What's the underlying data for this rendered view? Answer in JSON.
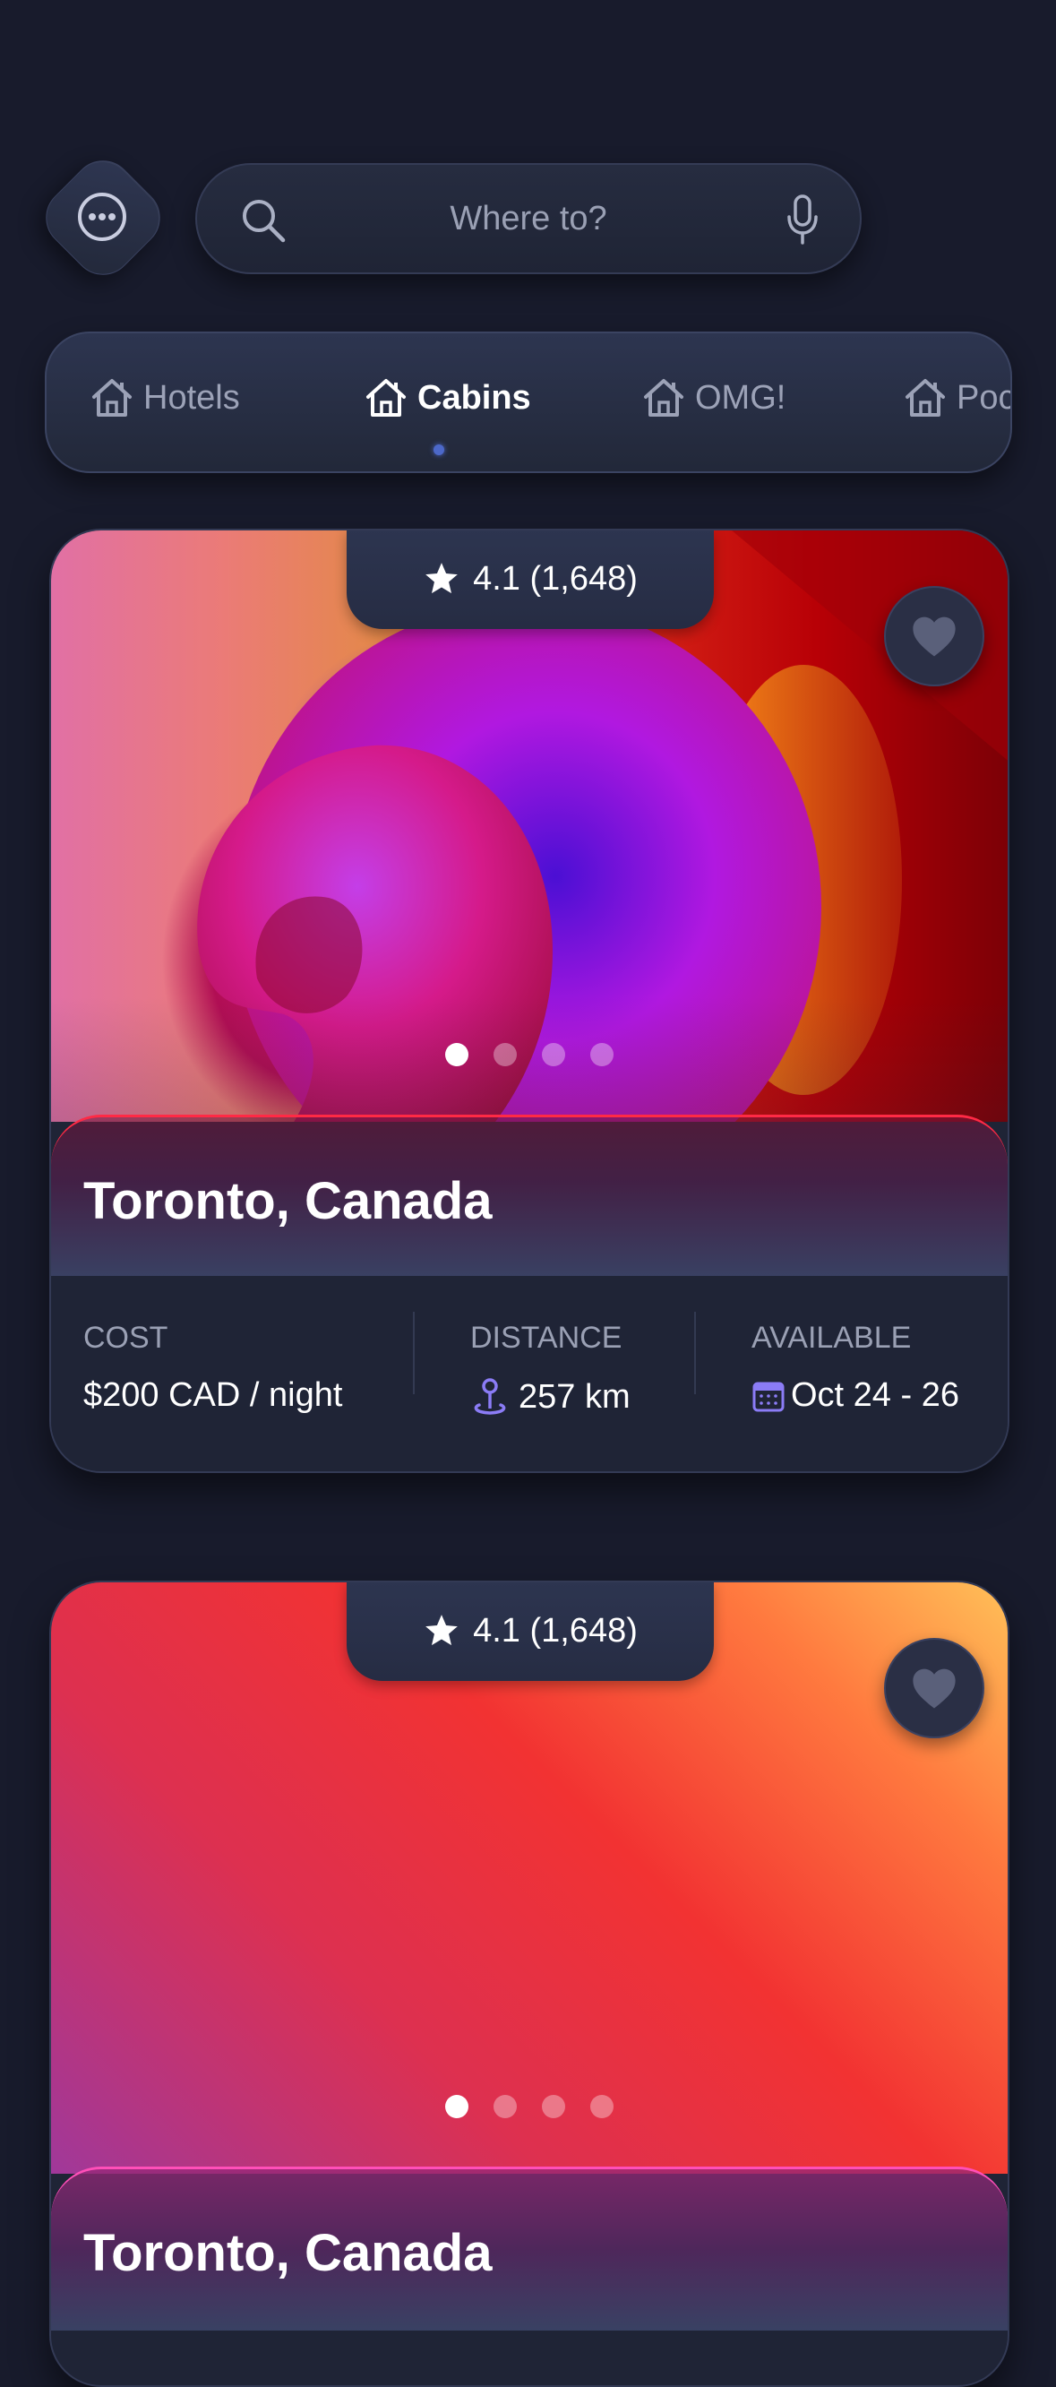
{
  "search": {
    "placeholder": "Where to?",
    "search_icon": "search-icon",
    "mic_icon": "microphone-icon"
  },
  "menu": {
    "icon": "more-horizontal-icon"
  },
  "categories": [
    {
      "label": "Hotels",
      "icon": "home-icon",
      "active": false
    },
    {
      "label": "Cabins",
      "icon": "home-icon",
      "active": true
    },
    {
      "label": "OMG!",
      "icon": "home-icon",
      "active": false
    },
    {
      "label": "Poc",
      "icon": "home-icon",
      "active": false
    }
  ],
  "colors": {
    "background": "#181b2c",
    "card": "#1f2436",
    "accent_dot": "#4c68c9",
    "icon_accent": "#8b7cf6"
  },
  "listings": [
    {
      "rating": "4.1 (1,648)",
      "city": "Toronto, Canada",
      "carousel": {
        "total": 4,
        "active": 1
      },
      "cost_label": "COST",
      "cost_value": "$200 CAD / night",
      "distance_label": "DISTANCE",
      "distance_value": "257 km",
      "available_label": "AVAILABLE",
      "available_value": "Oct 24 - 26"
    },
    {
      "rating": "4.1 (1,648)",
      "city": "Toronto, Canada",
      "carousel": {
        "total": 4,
        "active": 1
      }
    }
  ]
}
